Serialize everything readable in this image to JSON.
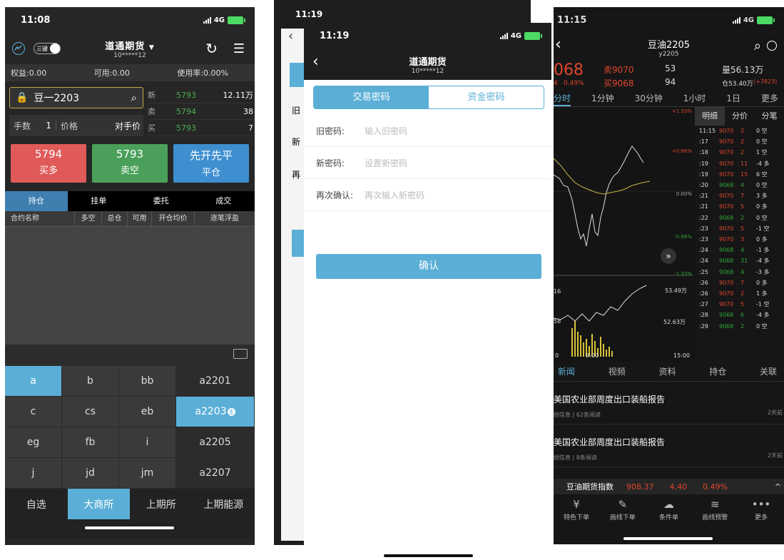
{
  "status": {
    "time1": "11:08",
    "time2": "11:19",
    "time2b": "11:19",
    "time3": "11:15",
    "network": "4G"
  },
  "screen1": {
    "title": "道通期货",
    "account": "10*****12",
    "toggle_label": "三键",
    "equity": "权益:0.00",
    "available": "可用:0.00",
    "usage": "使用率:0.00%",
    "contract": "豆一2203",
    "quotes": [
      {
        "label": "新",
        "price": "5793",
        "vol": "12.11万"
      },
      {
        "label": "卖",
        "price": "5794",
        "vol": "38"
      },
      {
        "label": "买",
        "price": "5793",
        "vol": "7"
      }
    ],
    "qty_label": "手数",
    "qty": "1",
    "price_label": "价格",
    "price_mode": "对手价",
    "buy_price": "5794",
    "buy_label": "买多",
    "sell_price": "5793",
    "sell_label": "卖空",
    "close_top": "先开先平",
    "close_label": "平仓",
    "tabs": [
      "持仓",
      "挂单",
      "委托",
      "成交"
    ],
    "columns": [
      "合约名称",
      "多空",
      "总仓",
      "可用",
      "开仓均价",
      "逐笔浮盈"
    ],
    "keys": [
      "a",
      "b",
      "bb",
      "a2201",
      "c",
      "cs",
      "eb",
      "a2203",
      "eg",
      "fb",
      "i",
      "a2205",
      "j",
      "jd",
      "jm",
      "a2207"
    ],
    "key_badge": "主",
    "exchanges": [
      "自选",
      "大商所",
      "上期所",
      "上期能源"
    ],
    "accent": "#5bafd6"
  },
  "screen2": {
    "back_labels": [
      "旧",
      "新",
      "再"
    ],
    "title": "道通期货",
    "account": "10*****12",
    "tab_active": "交易密码",
    "tab_inactive": "资金密码",
    "fields": [
      {
        "label": "旧密码:",
        "placeholder": "输入旧密码"
      },
      {
        "label": "新密码:",
        "placeholder": "设置新密码"
      },
      {
        "label": "再次确认:",
        "placeholder": "再次输入新密码"
      }
    ],
    "confirm": "确认"
  },
  "screen3": {
    "title": "豆油2205",
    "code": "y2205",
    "price": "068",
    "change_pct": "0.49%",
    "change_prefix": "4",
    "sell_label": "卖9070",
    "sell_vol": "53",
    "buy_label": "买9068",
    "buy_vol": "94",
    "volume": "量56.13万",
    "oi": "仓53.40万",
    "oi_change": "(+7823)",
    "intervals": [
      "分时",
      "1分钟",
      "30分钟",
      "1小时",
      "1日",
      "更多"
    ],
    "pct_labels": [
      "+1.33%",
      "+0.66%",
      "0.00%",
      "-0.66%",
      "-1.33%"
    ],
    "left_labels": [
      "4",
      "1",
      "4",
      "4"
    ],
    "vol_labels": [
      "53.49万",
      "52.63万"
    ],
    "vol_left": [
      "16",
      "58"
    ],
    "times": [
      "0",
      "9:00",
      "15:00"
    ],
    "detail_tabs": [
      "明细",
      "分价",
      "分笔"
    ],
    "ticks": [
      [
        "11:15",
        "9070",
        "2",
        "0 空"
      ],
      [
        ":17",
        "9070",
        "2",
        "0 空"
      ],
      [
        ":18",
        "9070",
        "2",
        "1 空"
      ],
      [
        ":19",
        "9070",
        "11",
        "-4 多"
      ],
      [
        ":19",
        "9070",
        "15",
        "6 空"
      ],
      [
        ":20",
        "9068",
        "4",
        "0 空"
      ],
      [
        ":21",
        "9070",
        "7",
        "3 多"
      ],
      [
        ":21",
        "9070",
        "5",
        "0 多"
      ],
      [
        ":22",
        "9068",
        "2",
        "0 空"
      ],
      [
        ":23",
        "9070",
        "5",
        "-1 空"
      ],
      [
        ":23",
        "9070",
        "3",
        "0 多"
      ],
      [
        ":24",
        "9068",
        "4",
        "-1 多"
      ],
      [
        ":24",
        "9068",
        "31",
        "-4 多"
      ],
      [
        ":25",
        "9068",
        "4",
        "-3 多"
      ],
      [
        ":26",
        "9070",
        "7",
        "0 多"
      ],
      [
        ":26",
        "9070",
        "2",
        "1 多"
      ],
      [
        ":27",
        "9070",
        "5",
        "-1 空"
      ],
      [
        ":28",
        "9068",
        "6",
        "-4 多"
      ],
      [
        ":29",
        "9068",
        "2",
        "0 空"
      ]
    ],
    "bottom_tabs": [
      "新闻",
      "视频",
      "资料",
      "持仓",
      "关联"
    ],
    "news": [
      {
        "title": "美国农业部周度出口装船报告",
        "meta": "创信息 | 62条阅读",
        "time": "2天前"
      },
      {
        "title": "美国农业部周度出口装船报告",
        "meta": "创信息 | 8条阅读",
        "time": "2天前"
      }
    ],
    "index_name": "豆油期货指数",
    "index_val": "908.37",
    "index_chg": "4.40",
    "index_pct": "0.49%",
    "toolbar": [
      "特色下单",
      "画线下单",
      "条件单",
      "画线预警",
      "更多"
    ]
  },
  "colors": {
    "red": "#e05a5a",
    "green": "#4aa05a",
    "blue": "#3e8ed0",
    "up": "#e0452e",
    "down": "#2fa53a"
  }
}
